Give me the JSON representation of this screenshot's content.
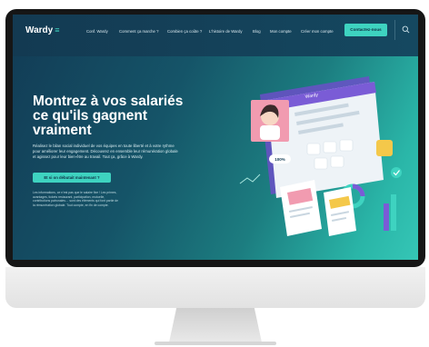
{
  "nav": {
    "logo": "Wardy",
    "links": [
      "Conf. Wardy",
      "Comment ça marche ?",
      "Combien ça coûte ?",
      "L'histoire de Wardy",
      "Blog",
      "Mon compte",
      "Créer mon compte"
    ],
    "cta": "Contactez-nous"
  },
  "hero": {
    "title": "Montrez à vos salariés ce qu'ils gagnent vraiment",
    "text": "Réalisez le bilan social individuel de vos équipes en toute liberté et à votre rythme pour améliorer leur engagement. Découvrez en ensemble leur rémunération globale et agissez pour leur bien-être au travail. Tout ça, grâce à Wardy.",
    "button": "Et si on débutait maintenant ?",
    "note": "Les informations, ce n'est pas que le salaire fixe ! Les primes, avantages, tickets restaurant, participation, mutuelle, contributions patronales… sont des éléments qui font partie de la rémunération globale. Tout compte, en fin de compte."
  },
  "illustration": {
    "card_label": "Wardy",
    "badge": "100%",
    "colors": {
      "teal": "#3ed3c0",
      "purple": "#7a5cd6",
      "yellow": "#f4c84a",
      "pink": "#f19bb0"
    }
  }
}
